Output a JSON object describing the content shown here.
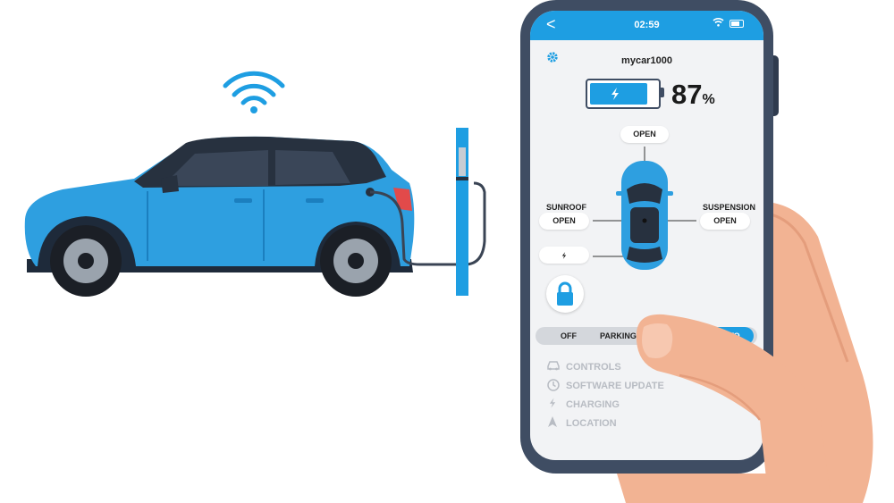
{
  "status_bar": {
    "back": "<",
    "time": "02:59",
    "wifi_icon": "wifi-icon",
    "battery_icon": "battery-icon"
  },
  "app": {
    "car_name": "mycar1000",
    "settings_icon": "gear-icon",
    "battery": {
      "percent_value": "87",
      "percent_sign": "%",
      "level": 0.87,
      "icon": "lightning-icon"
    },
    "doors": {
      "label": "OPEN"
    },
    "sunroof": {
      "label": "SUNROOF",
      "value": "OPEN"
    },
    "suspension": {
      "label": "SUSPENSION",
      "value": "OPEN"
    },
    "charge_icon": "lightning-icon",
    "lock_icon": "padlock-icon",
    "modes": [
      "OFF",
      "PARKING",
      "AUTO"
    ],
    "active_mode": "AUTO",
    "menu": [
      {
        "icon": "car-icon",
        "label": "CONTROLS"
      },
      {
        "icon": "clock-icon",
        "label": "SOFTWARE UPDATE"
      },
      {
        "icon": "lightning-icon",
        "label": "CHARGING"
      },
      {
        "icon": "location-arrow-icon",
        "label": "LOCATION"
      }
    ]
  },
  "colors": {
    "accent": "#1e9ee2",
    "car_body": "#2e9fe0",
    "phone_frame": "#3f4d63",
    "skin": "#f2b393"
  }
}
